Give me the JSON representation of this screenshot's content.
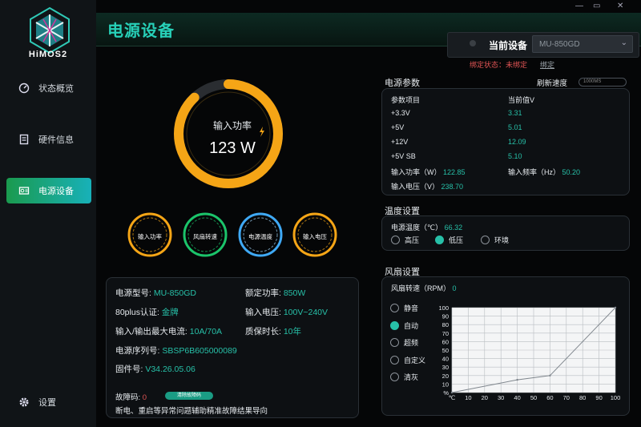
{
  "app": {
    "logo_text": "HiMOS2",
    "page_title": "电源设备"
  },
  "sidebar": {
    "items": [
      {
        "label": "状态概览",
        "icon": "gauge-icon"
      },
      {
        "label": "硬件信息",
        "icon": "document-icon"
      },
      {
        "label": "电源设备",
        "icon": "power-supply-icon",
        "active": true
      }
    ],
    "settings_label": "设置"
  },
  "header": {
    "current_device_label": "当前设备",
    "device_value": "MU-850GD",
    "bind_status_label": "绑定状态：",
    "bind_status_value": "未绑定",
    "bind_link": "绑定"
  },
  "gauge": {
    "main_label": "输入功率",
    "main_value": "123 W",
    "main_fraction": 0.88,
    "mini": [
      "输入功率",
      "风扇转速",
      "电源温度",
      "输入电压"
    ]
  },
  "device_info": {
    "model_label": "电源型号:",
    "model_value": "MU-850GD",
    "rated_power_label": "额定功率:",
    "rated_power_value": "850W",
    "cert_label": "80plus认证:",
    "cert_value": "金牌",
    "input_voltage_label": "输入电压:",
    "input_voltage_value": "100V~240V",
    "max_current_label": "输入/输出最大电流:",
    "max_current_value": "10A/70A",
    "warranty_label": "质保时长:",
    "warranty_value": "10年",
    "serial_label": "电源序列号:",
    "serial_value": "SBSP6B605000089",
    "firmware_label": "固件号:",
    "firmware_value": "V34.26.05.06",
    "fault_label": "故障码:",
    "fault_value": "0",
    "clear_fault_button": "清除故障码",
    "fault_note": "断电、重启等异常问题辅助精准故障结果导向"
  },
  "params": {
    "section_title": "电源参数",
    "refresh_label": "刷新速度",
    "refresh_value": "1000MS",
    "col_item": "参数项目",
    "col_value": "当前值V",
    "rows": [
      {
        "name": "+3.3V",
        "value": "3.31"
      },
      {
        "name": "+5V",
        "value": "5.01"
      },
      {
        "name": "+12V",
        "value": "12.09"
      },
      {
        "name": "+5V SB",
        "value": "5.10"
      }
    ],
    "input_power_label": "输入功率（W）",
    "input_power_value": "122.85",
    "input_freq_label": "输入频率（Hz）",
    "input_freq_value": "50.20",
    "input_voltage_label": "输入电压（V）",
    "input_voltage_value": "238.70"
  },
  "temperature": {
    "section_title": "温度设置",
    "temp_label": "电源温度（℃）",
    "temp_value": "66.32",
    "options": [
      "高压",
      "低压",
      "环境"
    ],
    "selected": 1
  },
  "fan": {
    "section_title": "风扇设置",
    "speed_label": "风扇转速（RPM）",
    "speed_value": "0",
    "modes": [
      "静音",
      "自动",
      "超频",
      "自定义",
      "清灰"
    ],
    "selected": 1
  },
  "chart_data": {
    "type": "line",
    "x": [
      0,
      40,
      60,
      100
    ],
    "y": [
      0,
      15,
      20,
      100
    ],
    "x_ticks": [
      "℃",
      "10",
      "20",
      "30",
      "40",
      "50",
      "60",
      "70",
      "80",
      "90",
      "100"
    ],
    "y_ticks": [
      "%",
      "10",
      "20",
      "30",
      "40",
      "50",
      "60",
      "70",
      "80",
      "90",
      "100"
    ],
    "xlim": [
      0,
      100
    ],
    "ylim": [
      0,
      100
    ],
    "grid": true
  },
  "colors": {
    "accent": "#27c0a8",
    "gauge_orange": "#f5a516",
    "green": "#1bc46a",
    "blue": "#3fa9f5",
    "alert": "#e05454"
  }
}
